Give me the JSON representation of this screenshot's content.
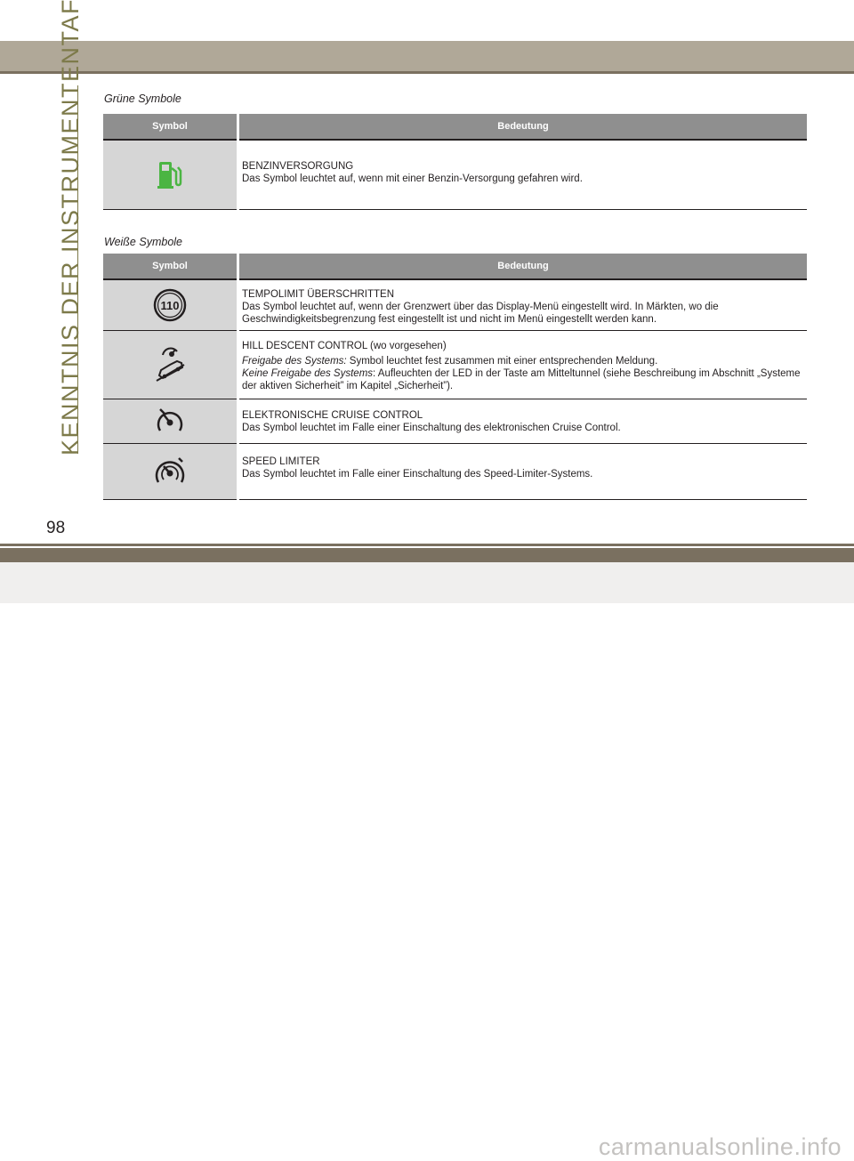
{
  "side_title": "KENNTNIS DER INSTRUMENTENTAFEL",
  "page_number": "98",
  "watermark": "carmanualsonline.info",
  "green_section": {
    "title": "Grüne Symbole",
    "headers": {
      "symbol": "Symbol",
      "meaning": "Bedeutung"
    },
    "rows": [
      {
        "icon": "fuel-pump-icon",
        "icon_color": "#4bb543",
        "name": "BENZINVERSORGUNG",
        "desc": "Das Symbol leuchtet auf, wenn mit einer Benzin-Versorgung gefahren wird."
      }
    ]
  },
  "white_section": {
    "title": "Weiße Symbole",
    "headers": {
      "symbol": "Symbol",
      "meaning": "Bedeutung"
    },
    "rows": [
      {
        "icon": "speed-limit-110-icon",
        "icon_text": "110",
        "name": "TEMPOLIMIT ÜBERSCHRITTEN",
        "desc": "Das Symbol leuchtet auf, wenn der Grenzwert über das Display-Menü eingestellt wird. In Märkten, wo die Geschwindigkeitsbegrenzung fest eingestellt ist und nicht im Menü eingestellt werden kann."
      },
      {
        "icon": "hill-descent-icon",
        "name": "HILL DESCENT CONTROL (wo vorgesehen)",
        "line1_label": "Freigabe des Systems:",
        "line1_text": " Symbol leuchtet fest zusammen mit einer entsprechenden Meldung.",
        "line2_label": "Keine Freigabe des Systems",
        "line2_text": ": Aufleuchten der LED in der Taste am Mitteltunnel (siehe Beschreibung im Abschnitt „Systeme der aktiven Sicherheit” im Kapitel „Sicherheit”)."
      },
      {
        "icon": "cruise-control-icon",
        "name": "ELEKTRONISCHE CRUISE CONTROL",
        "desc": "Das Symbol leuchtet im Falle einer Einschaltung des elektronischen Cruise Control."
      },
      {
        "icon": "speed-limiter-icon",
        "name": "SPEED LIMITER",
        "desc": "Das Symbol leuchtet im Falle einer Einschaltung des Speed-Limiter-Systems."
      }
    ]
  }
}
